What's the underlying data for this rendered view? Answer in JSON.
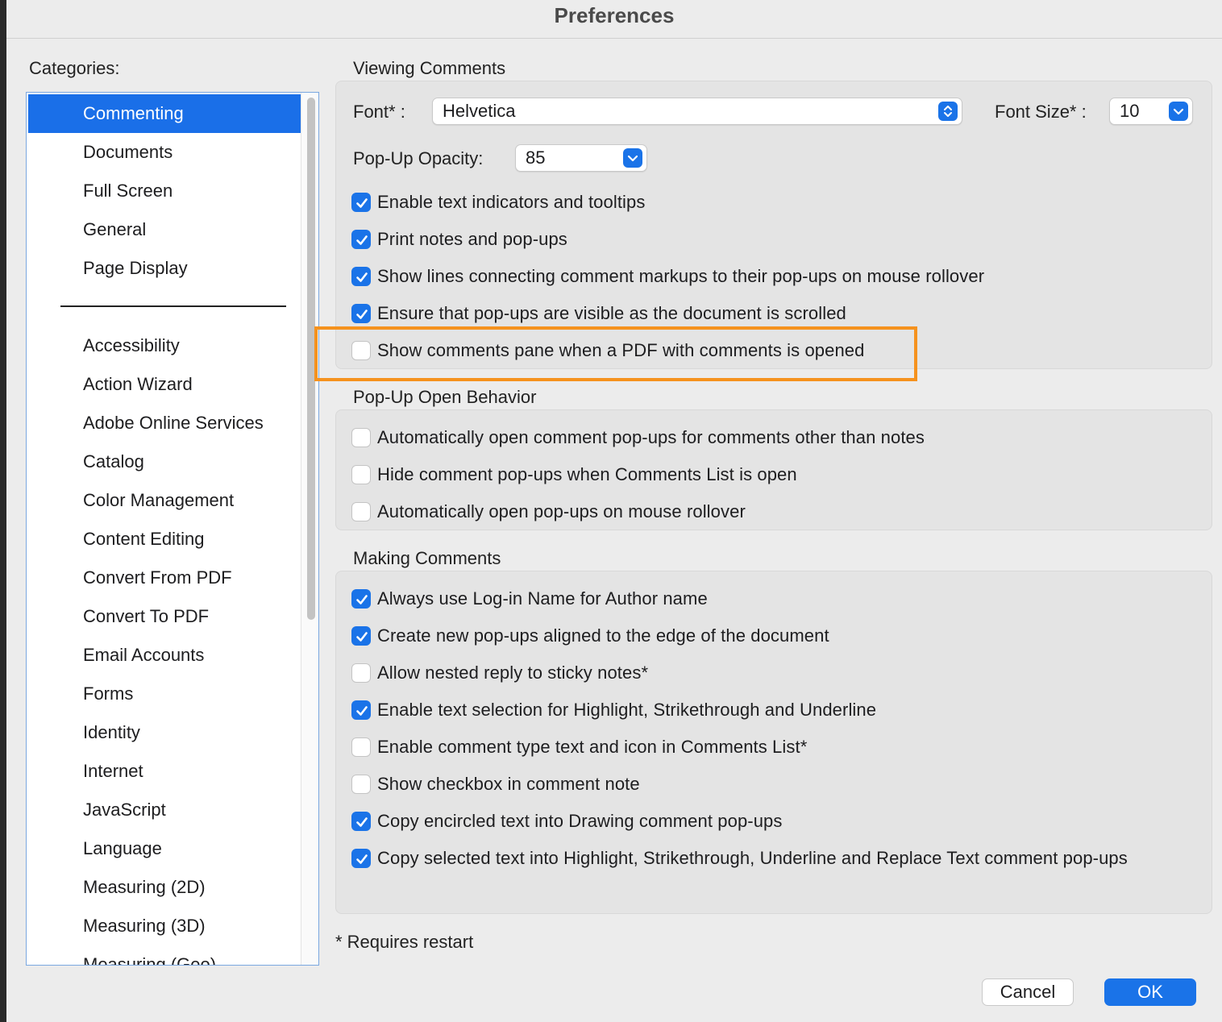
{
  "window": {
    "title": "Preferences"
  },
  "categories": {
    "label": "Categories:",
    "top_items": [
      "Commenting",
      "Documents",
      "Full Screen",
      "General",
      "Page Display"
    ],
    "selected": "Commenting",
    "other_items": [
      "Accessibility",
      "Action Wizard",
      "Adobe Online Services",
      "Catalog",
      "Color Management",
      "Content Editing",
      "Convert From PDF",
      "Convert To PDF",
      "Email Accounts",
      "Forms",
      "Identity",
      "Internet",
      "JavaScript",
      "Language",
      "Measuring (2D)",
      "Measuring (3D)",
      "Measuring (Geo)"
    ]
  },
  "viewing": {
    "title": "Viewing Comments",
    "font_label": "Font* :",
    "font_value": "Helvetica",
    "font_size_label": "Font Size* :",
    "font_size_value": "10",
    "opacity_label": "Pop-Up Opacity:",
    "opacity_value": "85",
    "options": [
      {
        "label": "Enable text indicators and tooltips",
        "checked": true
      },
      {
        "label": "Print notes and pop-ups",
        "checked": true
      },
      {
        "label": "Show lines connecting comment markups to their pop-ups on mouse rollover",
        "checked": true
      },
      {
        "label": "Ensure that pop-ups are visible as the document is scrolled",
        "checked": true
      },
      {
        "label": "Show comments pane when a PDF with comments is opened",
        "checked": false
      }
    ]
  },
  "popup": {
    "title": "Pop-Up Open Behavior",
    "options": [
      {
        "label": "Automatically open comment pop-ups for comments other than notes",
        "checked": false
      },
      {
        "label": "Hide comment pop-ups when Comments List is open",
        "checked": false
      },
      {
        "label": "Automatically open pop-ups on mouse rollover",
        "checked": false
      }
    ]
  },
  "making": {
    "title": "Making Comments",
    "options": [
      {
        "label": "Always use Log-in Name for Author name",
        "checked": true
      },
      {
        "label": "Create new pop-ups aligned to the edge of the document",
        "checked": true
      },
      {
        "label": "Allow nested reply to sticky notes*",
        "checked": false
      },
      {
        "label": "Enable text selection for Highlight, Strikethrough and Underline",
        "checked": true
      },
      {
        "label": "Enable comment type text and icon in Comments List*",
        "checked": false
      },
      {
        "label": "Show checkbox in comment note",
        "checked": false
      },
      {
        "label": "Copy encircled text into Drawing comment pop-ups",
        "checked": true
      },
      {
        "label": "Copy selected text into Highlight, Strikethrough, Underline and Replace Text comment pop-ups",
        "checked": true
      }
    ]
  },
  "footnote": "* Requires restart",
  "buttons": {
    "cancel": "Cancel",
    "ok": "OK"
  },
  "colors": {
    "accent": "#1a73e8",
    "selection": "#1a6fe8",
    "highlight": "#f5921e"
  }
}
